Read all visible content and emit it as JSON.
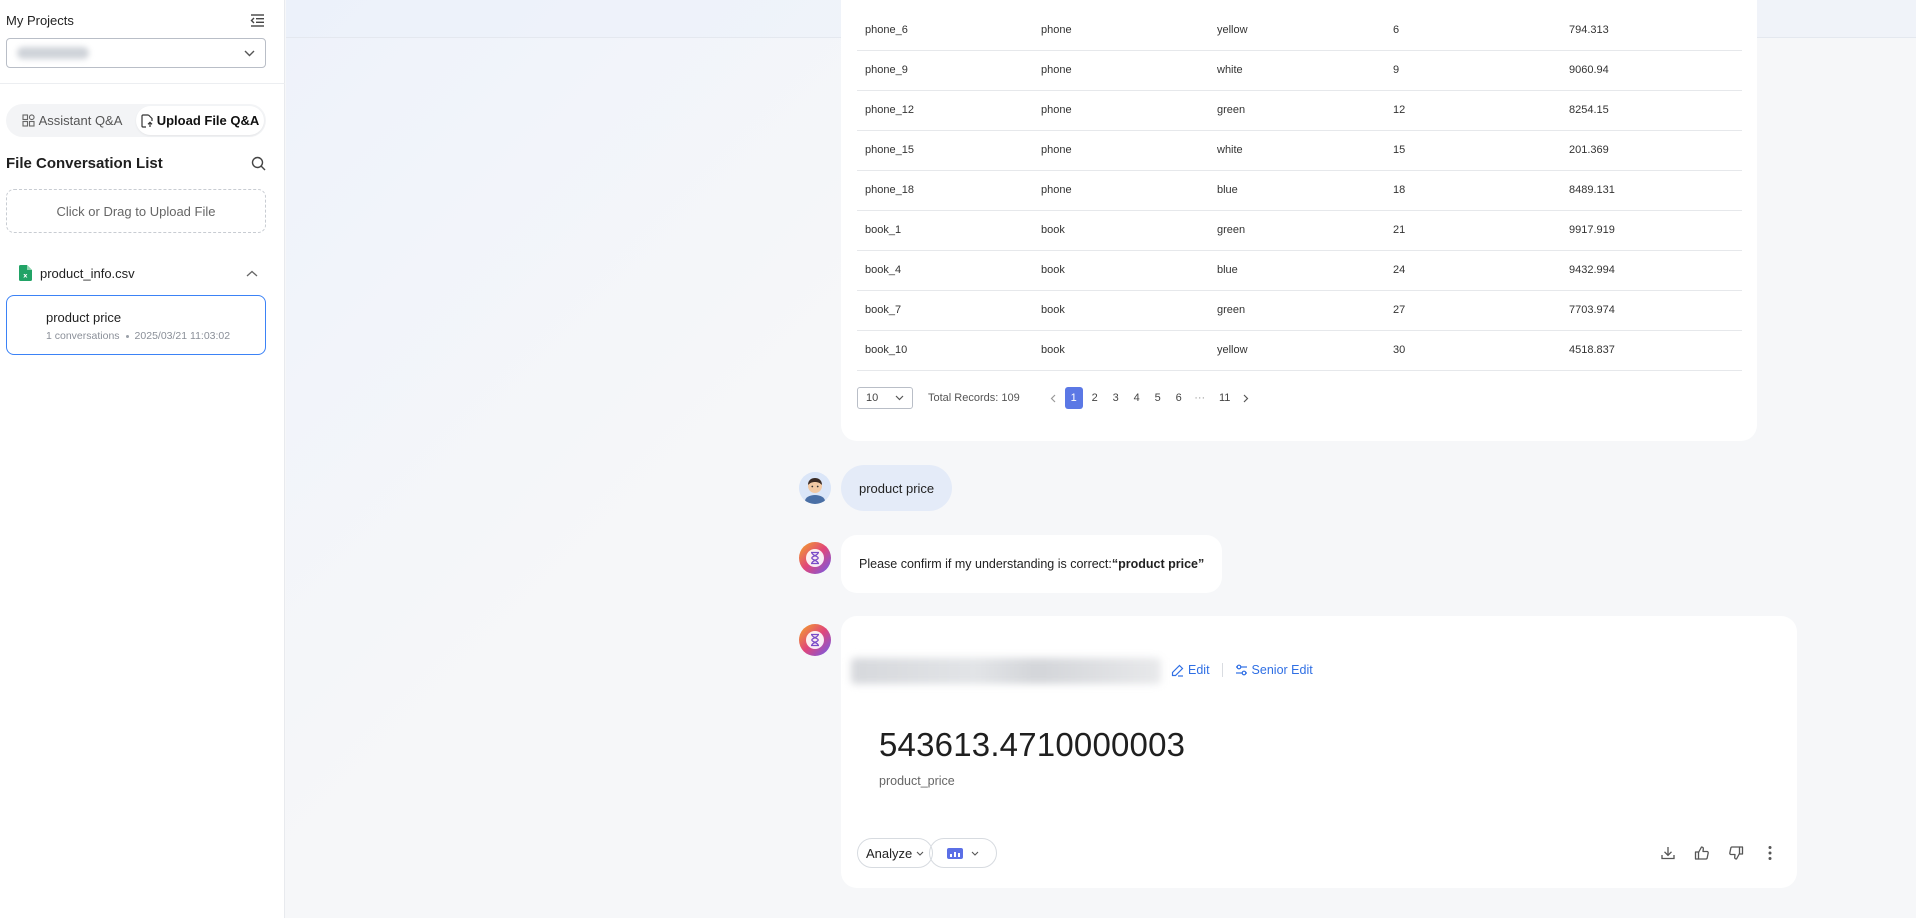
{
  "sidebar": {
    "title": "My Projects",
    "project_select": {
      "value": ""
    },
    "mode_tabs": [
      {
        "label": "Assistant Q&A",
        "active": false
      },
      {
        "label": "Upload File Q&A",
        "active": true
      }
    ],
    "conversation_list_title": "File Conversation List",
    "upload_label": "Click or Drag to Upload File",
    "file": {
      "name": "product_info.csv",
      "icon": "spreadsheet-icon",
      "expanded": true
    },
    "conversations": [
      {
        "title": "product price",
        "count": "1 conversations",
        "timestamp": "2025/03/21 11:03:02"
      }
    ]
  },
  "table": {
    "rows": [
      [
        "phone_6",
        "phone",
        "yellow",
        "6",
        "794.313"
      ],
      [
        "phone_9",
        "phone",
        "white",
        "9",
        "9060.94"
      ],
      [
        "phone_12",
        "phone",
        "green",
        "12",
        "8254.15"
      ],
      [
        "phone_15",
        "phone",
        "white",
        "15",
        "201.369"
      ],
      [
        "phone_18",
        "phone",
        "blue",
        "18",
        "8489.131"
      ],
      [
        "book_1",
        "book",
        "green",
        "21",
        "9917.919"
      ],
      [
        "book_4",
        "book",
        "blue",
        "24",
        "9432.994"
      ],
      [
        "book_7",
        "book",
        "green",
        "27",
        "7703.974"
      ],
      [
        "book_10",
        "book",
        "yellow",
        "30",
        "4518.837"
      ]
    ],
    "pagination": {
      "page_size": "10",
      "total": "Total Records: 109",
      "pages": [
        "1",
        "2",
        "3",
        "4",
        "5",
        "6"
      ],
      "ellipsis": "···",
      "last_page": "11",
      "current": "1"
    }
  },
  "chat": {
    "user_message": "product price",
    "bot_confirm_prefix": "Please confirm if my understanding is correct:",
    "bot_confirm_quote": "“product price”",
    "result": {
      "edit_label": "Edit",
      "senior_edit_label": "Senior Edit",
      "value": "543613.4710000003",
      "value_label": "product_price",
      "analyze_label": "Analyze"
    }
  },
  "colors": {
    "accent": "#2f6fe4",
    "pagination_active": "#5b78e5",
    "card_border": "#3b82f6",
    "excel_green": "#21a366"
  }
}
